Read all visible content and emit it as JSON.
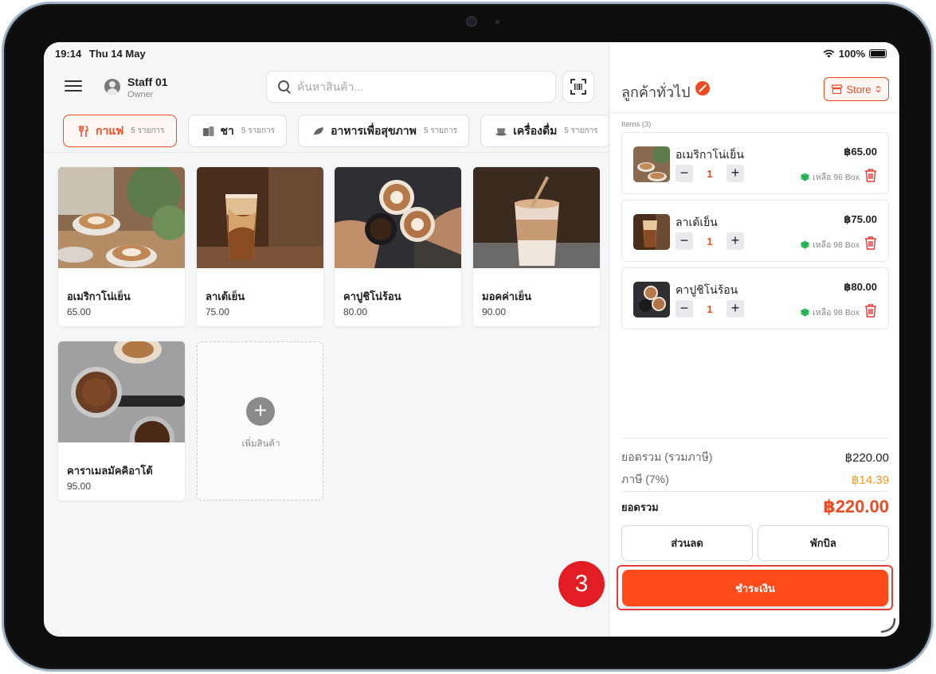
{
  "status_bar": {
    "time": "19:14",
    "date": "Thu 14 May",
    "battery": "100%"
  },
  "header": {
    "staff_name": "Staff 01",
    "staff_role": "Owner",
    "search_placeholder": "ค้นหาสินค้า..."
  },
  "categories": [
    {
      "name": "กาแฟ",
      "count": "5 รายการ",
      "active": true,
      "icon": "utensils-icon"
    },
    {
      "name": "ชา",
      "count": "5 รายการ",
      "active": false,
      "icon": "tea-box-icon"
    },
    {
      "name": "อาหารเพื่อสุขภาพ",
      "count": "5 รายการ",
      "active": false,
      "icon": "leaf-icon"
    },
    {
      "name": "เครื่องดื่ม",
      "count": "5 รายการ",
      "active": false,
      "icon": "cup-icon"
    }
  ],
  "products": [
    {
      "name": "อเมริกาโน่เย็น",
      "price": "65.00"
    },
    {
      "name": "ลาเต้เย็น",
      "price": "75.00"
    },
    {
      "name": "คาปูชิโน่ร้อน",
      "price": "80.00"
    },
    {
      "name": "มอคค่าเย็น",
      "price": "90.00"
    },
    {
      "name": "คาราเมลมัคคิอาโต้",
      "price": "95.00"
    }
  ],
  "add_product_label": "เพิ่มสินค้า",
  "cart": {
    "customer_name": "ลูกค้าทั่วไป",
    "store_label": "Store",
    "items_label": "Items (3)",
    "items": [
      {
        "name": "อเมริกาโน่เย็น",
        "price": "฿65.00",
        "qty": "1",
        "stock": "เหลือ 96 Box"
      },
      {
        "name": "ลาเต้เย็น",
        "price": "฿75.00",
        "qty": "1",
        "stock": "เหลือ 98 Box"
      },
      {
        "name": "คาปูชิโน่ร้อน",
        "price": "฿80.00",
        "qty": "1",
        "stock": "เหลือ 98 Box"
      }
    ],
    "subtotal_label": "ยอดรวม (รวมภาษี)",
    "subtotal_value": "฿220.00",
    "tax_label": "ภาษี (7%)",
    "tax_value": "฿14.39",
    "total_label": "ยอดรวม",
    "total_value": "฿220.00",
    "discount_label": "ส่วนลด",
    "hold_label": "พักบิล",
    "pay_label": "ชำระเงิน"
  },
  "step_badge": "3",
  "colors": {
    "accent": "#ef4a22",
    "pay": "#ff4a1a",
    "tax": "#f09a1f",
    "stock_icon": "#2fbf5b",
    "badge": "#e21d24"
  }
}
